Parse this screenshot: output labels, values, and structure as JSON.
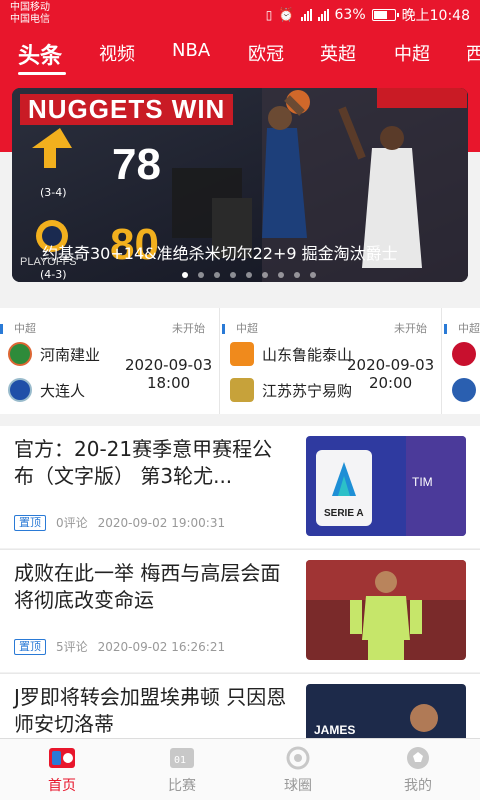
{
  "status_bar": {
    "carrier1": "中国移动",
    "carrier2": "中国电信",
    "network": "4G",
    "battery": "63%",
    "time": "晚上10:48"
  },
  "tabs": [
    "头条",
    "视频",
    "NBA",
    "欧冠",
    "英超",
    "中超",
    "西"
  ],
  "banner": {
    "headline": "NUGGETS WIN",
    "team1_score": "78",
    "team1_record": "(3-4)",
    "team2_score": "80",
    "team2_record": "(4-3)",
    "playoffs_tag": "PLAYOFFS",
    "caption": "约基奇30+14&准绝杀米切尔22+9 掘金淘汰爵士",
    "slides_total": 9,
    "slide_active": 1
  },
  "matches": [
    {
      "league": "中超",
      "status": "未开始",
      "home": "河南建业",
      "away": "大连人",
      "date": "2020-09-03",
      "time": "18:00"
    },
    {
      "league": "中超",
      "status": "未开始",
      "home": "山东鲁能泰山",
      "away": "江苏苏宁易购",
      "date": "2020-09-03",
      "time": "20:00"
    },
    {
      "league": "中超",
      "status": "",
      "home": "",
      "away": "",
      "date": "",
      "time": ""
    }
  ],
  "news": [
    {
      "title": "官方：20-21赛季意甲赛程公布（文字版） 第3轮尤...",
      "pinned": "置顶",
      "comments": "0评论",
      "time": "2020-09-02 19:00:31"
    },
    {
      "title": "成败在此一举 梅西与高层会面将彻底改变命运",
      "pinned": "置顶",
      "comments": "5评论",
      "time": "2020-09-02 16:26:21"
    },
    {
      "title": "J罗即将转会加盟埃弗顿 只因恩师安切洛蒂",
      "pinned": "",
      "comments": "",
      "time": ""
    }
  ],
  "bottom_nav": [
    "首页",
    "比赛",
    "球圈",
    "我的"
  ],
  "colors": {
    "brand_red": "#e8162c",
    "accent_blue": "#2a7ad6"
  }
}
